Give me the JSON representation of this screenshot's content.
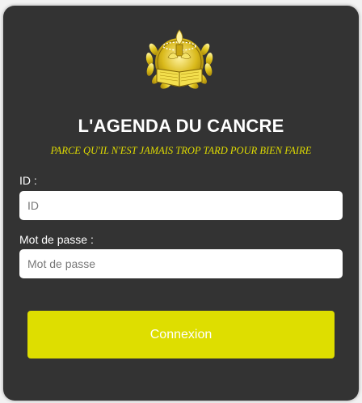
{
  "brand": {
    "logo_icon": "gold-torch-book-laurel-emblem-icon",
    "accent_color": "#dede00"
  },
  "header": {
    "title": "L'AGENDA DU CANCRE",
    "tagline": "PARCE QU'IL N'EST JAMAIS TROP TARD POUR BIEN FAIRE"
  },
  "form": {
    "id_label": "ID :",
    "id_placeholder": "ID",
    "id_value": "",
    "password_label": "Mot de passe :",
    "password_placeholder": "Mot de passe",
    "password_value": "",
    "submit_label": "Connexion"
  }
}
